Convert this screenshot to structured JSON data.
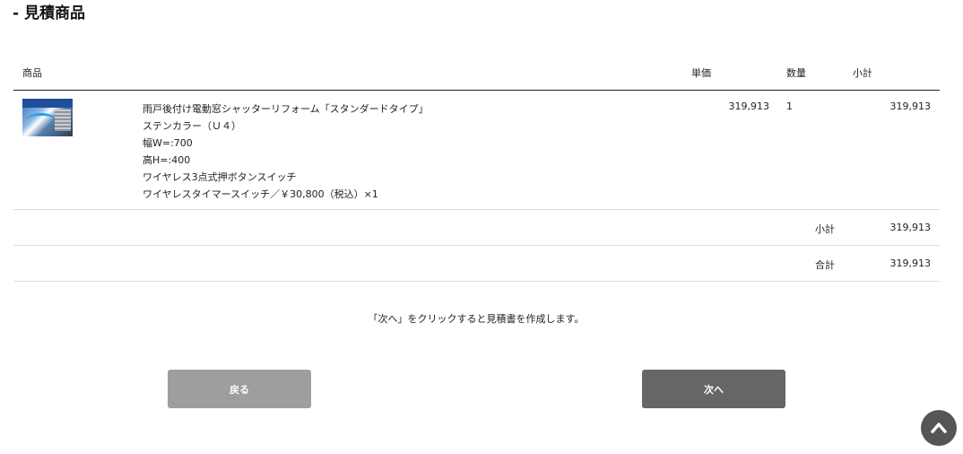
{
  "section": {
    "title": "- 見積商品"
  },
  "table": {
    "headers": {
      "product": "商品",
      "unit_price": "単価",
      "quantity": "数量",
      "subtotal": "小計"
    },
    "items": [
      {
        "thumbnail_icon": "product-thumbnail-image",
        "lines": [
          "雨戸後付け電動窓シャッターリフォーム「スタンダードタイプ」",
          "ステンカラー（Ｕ４）",
          "幅W=:700",
          "高H=:400",
          "ワイヤレス3点式押ボタンスイッチ",
          "ワイヤレスタイマースイッチ／￥30,800（税込）×1"
        ],
        "unit_price": "319,913",
        "quantity": "1",
        "subtotal": "319,913"
      }
    ],
    "summary": {
      "subtotal_label": "小計",
      "subtotal_value": "319,913",
      "total_label": "合計",
      "total_value": "319,913"
    }
  },
  "note": "「次へ」をクリックすると見積書を作成します。",
  "buttons": {
    "back": "戻る",
    "next": "次へ"
  },
  "scroll_top": {
    "icon": "chevron-up-icon"
  },
  "colors": {
    "back_button": "#9e9e9e",
    "next_button": "#666666",
    "scroll_top": "#555555"
  }
}
